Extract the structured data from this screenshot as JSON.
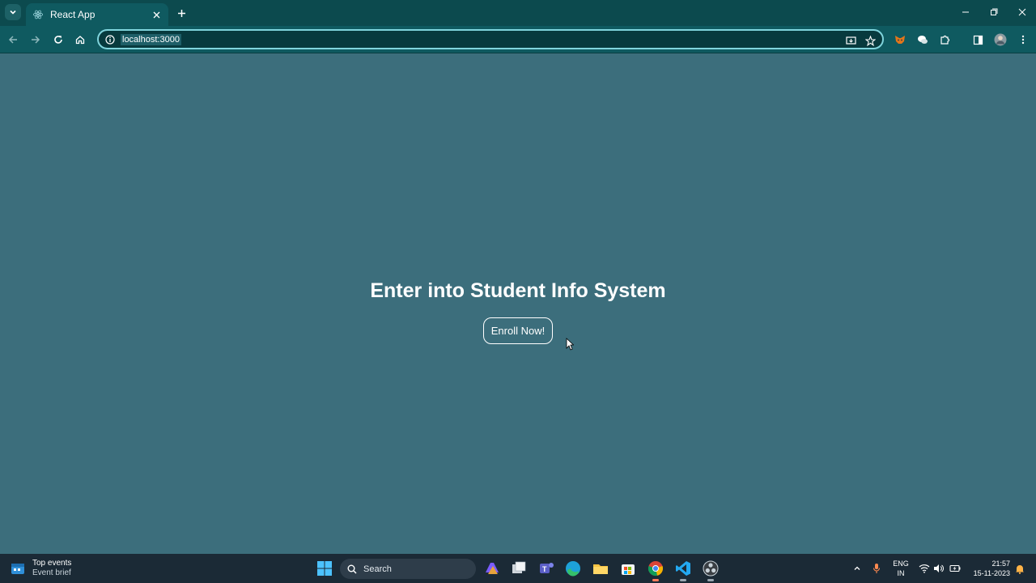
{
  "browser": {
    "tab_title": "React App",
    "url": "localhost:3000"
  },
  "page": {
    "heading": "Enter into Student Info System",
    "enroll_button": "Enroll Now!"
  },
  "taskbar": {
    "widget_title": "Top events",
    "widget_subtitle": "Event brief",
    "search_label": "Search",
    "lang_line1": "ENG",
    "lang_line2": "IN",
    "time": "21:57",
    "date": "15-11-2023"
  },
  "colors": {
    "page_background": "#3c6e7c",
    "browser_chrome": "#0f5a60",
    "taskbar": "#1b2a36"
  }
}
